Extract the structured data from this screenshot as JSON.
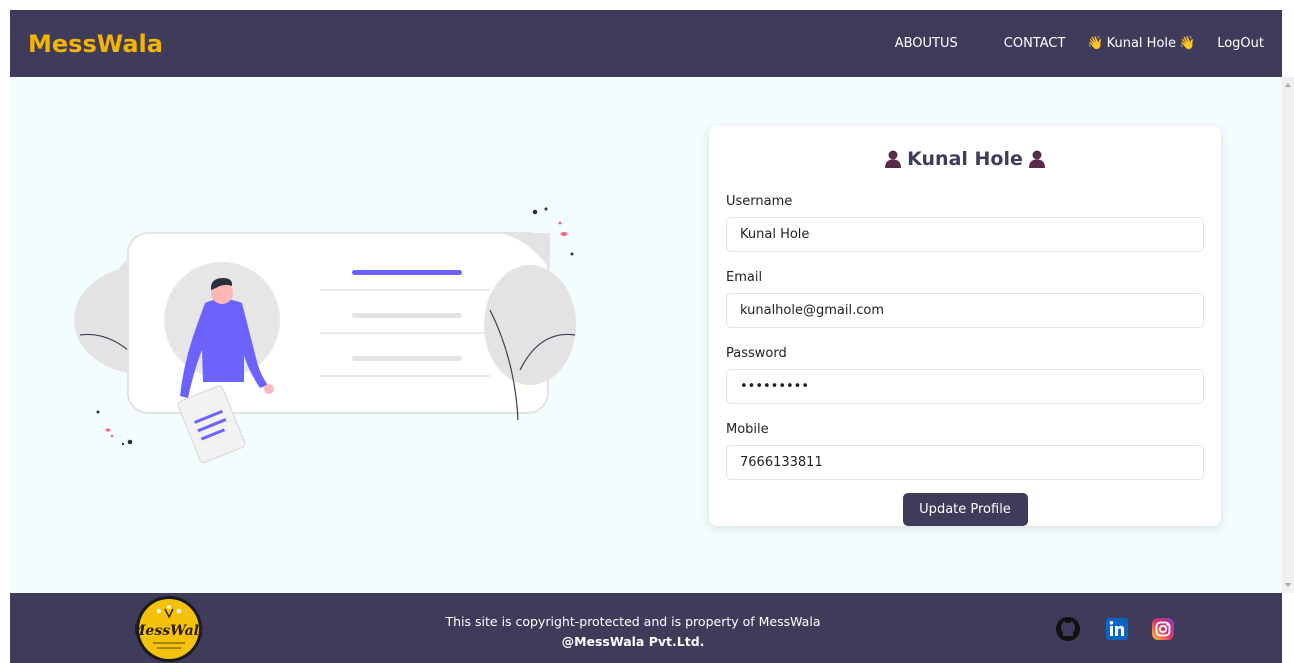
{
  "navbar": {
    "brand": "MessWala",
    "links": {
      "about": "ABOUTUS",
      "contact": "CONTACT",
      "logout": "LogOut"
    },
    "user_name": "Kunal Hole",
    "user_emoji": "👋"
  },
  "profile": {
    "title": "Kunal Hole",
    "fields": {
      "username": {
        "label": "Username",
        "value": "Kunal Hole"
      },
      "email": {
        "label": "Email",
        "value": "kunalhole@gmail.com"
      },
      "password": {
        "label": "Password",
        "value": "kunalhole"
      },
      "mobile": {
        "label": "Mobile",
        "value": "7666133811"
      }
    },
    "update_button": "Update Profile"
  },
  "footer": {
    "line1": "This site is copyright-protected and is property of MessWala",
    "line2": "@MessWala Pvt.Ltd.",
    "logo_text": "MessWala",
    "social_icons": [
      "github-icon",
      "linkedin-icon",
      "instagram-icon"
    ]
  },
  "colors": {
    "navbar_bg": "#3f3c5b",
    "brand": "#f4b400",
    "accent": "#6c63ff",
    "page_bg": "#f4fdfd"
  }
}
